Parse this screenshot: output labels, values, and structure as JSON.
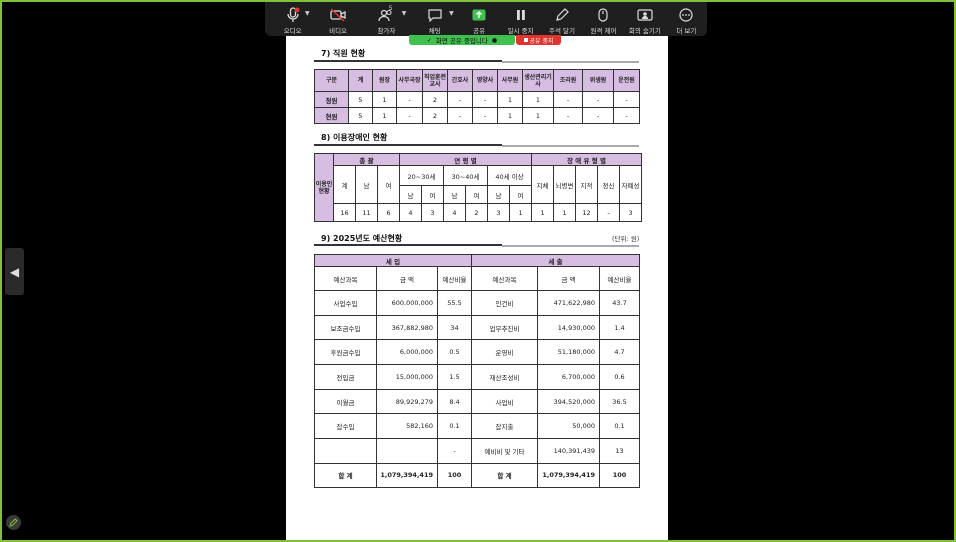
{
  "toolbar": {
    "audio": {
      "label": "오디오",
      "icon": "mic-icon"
    },
    "video": {
      "label": "비디오",
      "icon": "video-off-icon"
    },
    "participants": {
      "label": "참가자",
      "count": "5",
      "icon": "participants-icon"
    },
    "chat": {
      "label": "채팅",
      "icon": "chat-icon"
    },
    "share": {
      "label": "공유",
      "icon": "share-screen-icon"
    },
    "pause": {
      "label": "일시 중지",
      "icon": "pause-icon"
    },
    "annotate": {
      "label": "주석 달기",
      "icon": "pen-icon"
    },
    "remote": {
      "label": "원격 제어",
      "icon": "mouse-icon"
    },
    "hide": {
      "label": "회의 숨기기",
      "icon": "hide-meeting-icon"
    },
    "more": {
      "label": "더 보기",
      "icon": "ellipsis-icon"
    }
  },
  "share_banner": {
    "text": "화면 공유 중입니다",
    "stop_label": "공유 중지"
  },
  "colors": {
    "accent_green": "#3ec14e",
    "stop_red": "#e2342f",
    "table_header": "#d8bde3",
    "frame": "#7ec23a"
  },
  "doc": {
    "s7": {
      "title": "7) 직원 현황",
      "headers": [
        "구분",
        "계",
        "원장",
        "사무국장",
        "직업훈련교사",
        "간호사",
        "영양사",
        "사무원",
        "생산관리기사",
        "조리원",
        "위생원",
        "운전원"
      ],
      "rows": [
        {
          "label": "정원",
          "cells": [
            "5",
            "1",
            "-",
            "2",
            "-",
            "-",
            "1",
            "1",
            "-",
            "-",
            "-"
          ]
        },
        {
          "label": "현원",
          "cells": [
            "5",
            "1",
            "-",
            "2",
            "-",
            "-",
            "1",
            "1",
            "-",
            "-",
            "-"
          ]
        }
      ]
    },
    "s8": {
      "title": "8) 이용장애인 현황",
      "row_header": "이용인현황",
      "total_header": "총 괄",
      "age_header": "연 령 별",
      "disability_header": "장 애 유 형 별",
      "total_sub": [
        "계",
        "남",
        "여"
      ],
      "age_groups": [
        "20~30세",
        "30~40세",
        "40세 이상"
      ],
      "gender": [
        "남",
        "여"
      ],
      "disability_types": [
        "지체",
        "뇌병변",
        "지적",
        "정신",
        "자폐성"
      ],
      "values": [
        "16",
        "11",
        "6",
        "4",
        "3",
        "4",
        "2",
        "3",
        "1",
        "1",
        "1",
        "12",
        "-",
        "3"
      ]
    },
    "s9": {
      "title": "9) 2025년도 예산현황",
      "unit": "(단위: 원)",
      "income_header": "세 입",
      "expense_header": "세 출",
      "col_headers": [
        "예산과목",
        "금 액",
        "예산비율",
        "예산과목",
        "금 액",
        "예산비율"
      ],
      "rows": [
        [
          "사업수입",
          "600,000,000",
          "55.5",
          "인건비",
          "471,622,980",
          "43.7"
        ],
        [
          "보조금수입",
          "367,882,980",
          "34",
          "업무추진비",
          "14,930,000",
          "1.4"
        ],
        [
          "후원금수입",
          "6,000,000",
          "0.5",
          "운영비",
          "51,180,000",
          "4.7"
        ],
        [
          "전입금",
          "15,000,000",
          "1.5",
          "재산조성비",
          "6,700,000",
          "0.6"
        ],
        [
          "이월금",
          "89,929,279",
          "8.4",
          "사업비",
          "394,520,000",
          "36.5"
        ],
        [
          "잡수입",
          "582,160",
          "0.1",
          "잡지출",
          "50,000",
          "0.1"
        ],
        [
          "",
          "",
          "-",
          "예비비 및 기타",
          "140,391,439",
          "13"
        ]
      ],
      "total": [
        "합 계",
        "1,079,394,419",
        "100",
        "합 계",
        "1,079,394,419",
        "100"
      ]
    }
  }
}
